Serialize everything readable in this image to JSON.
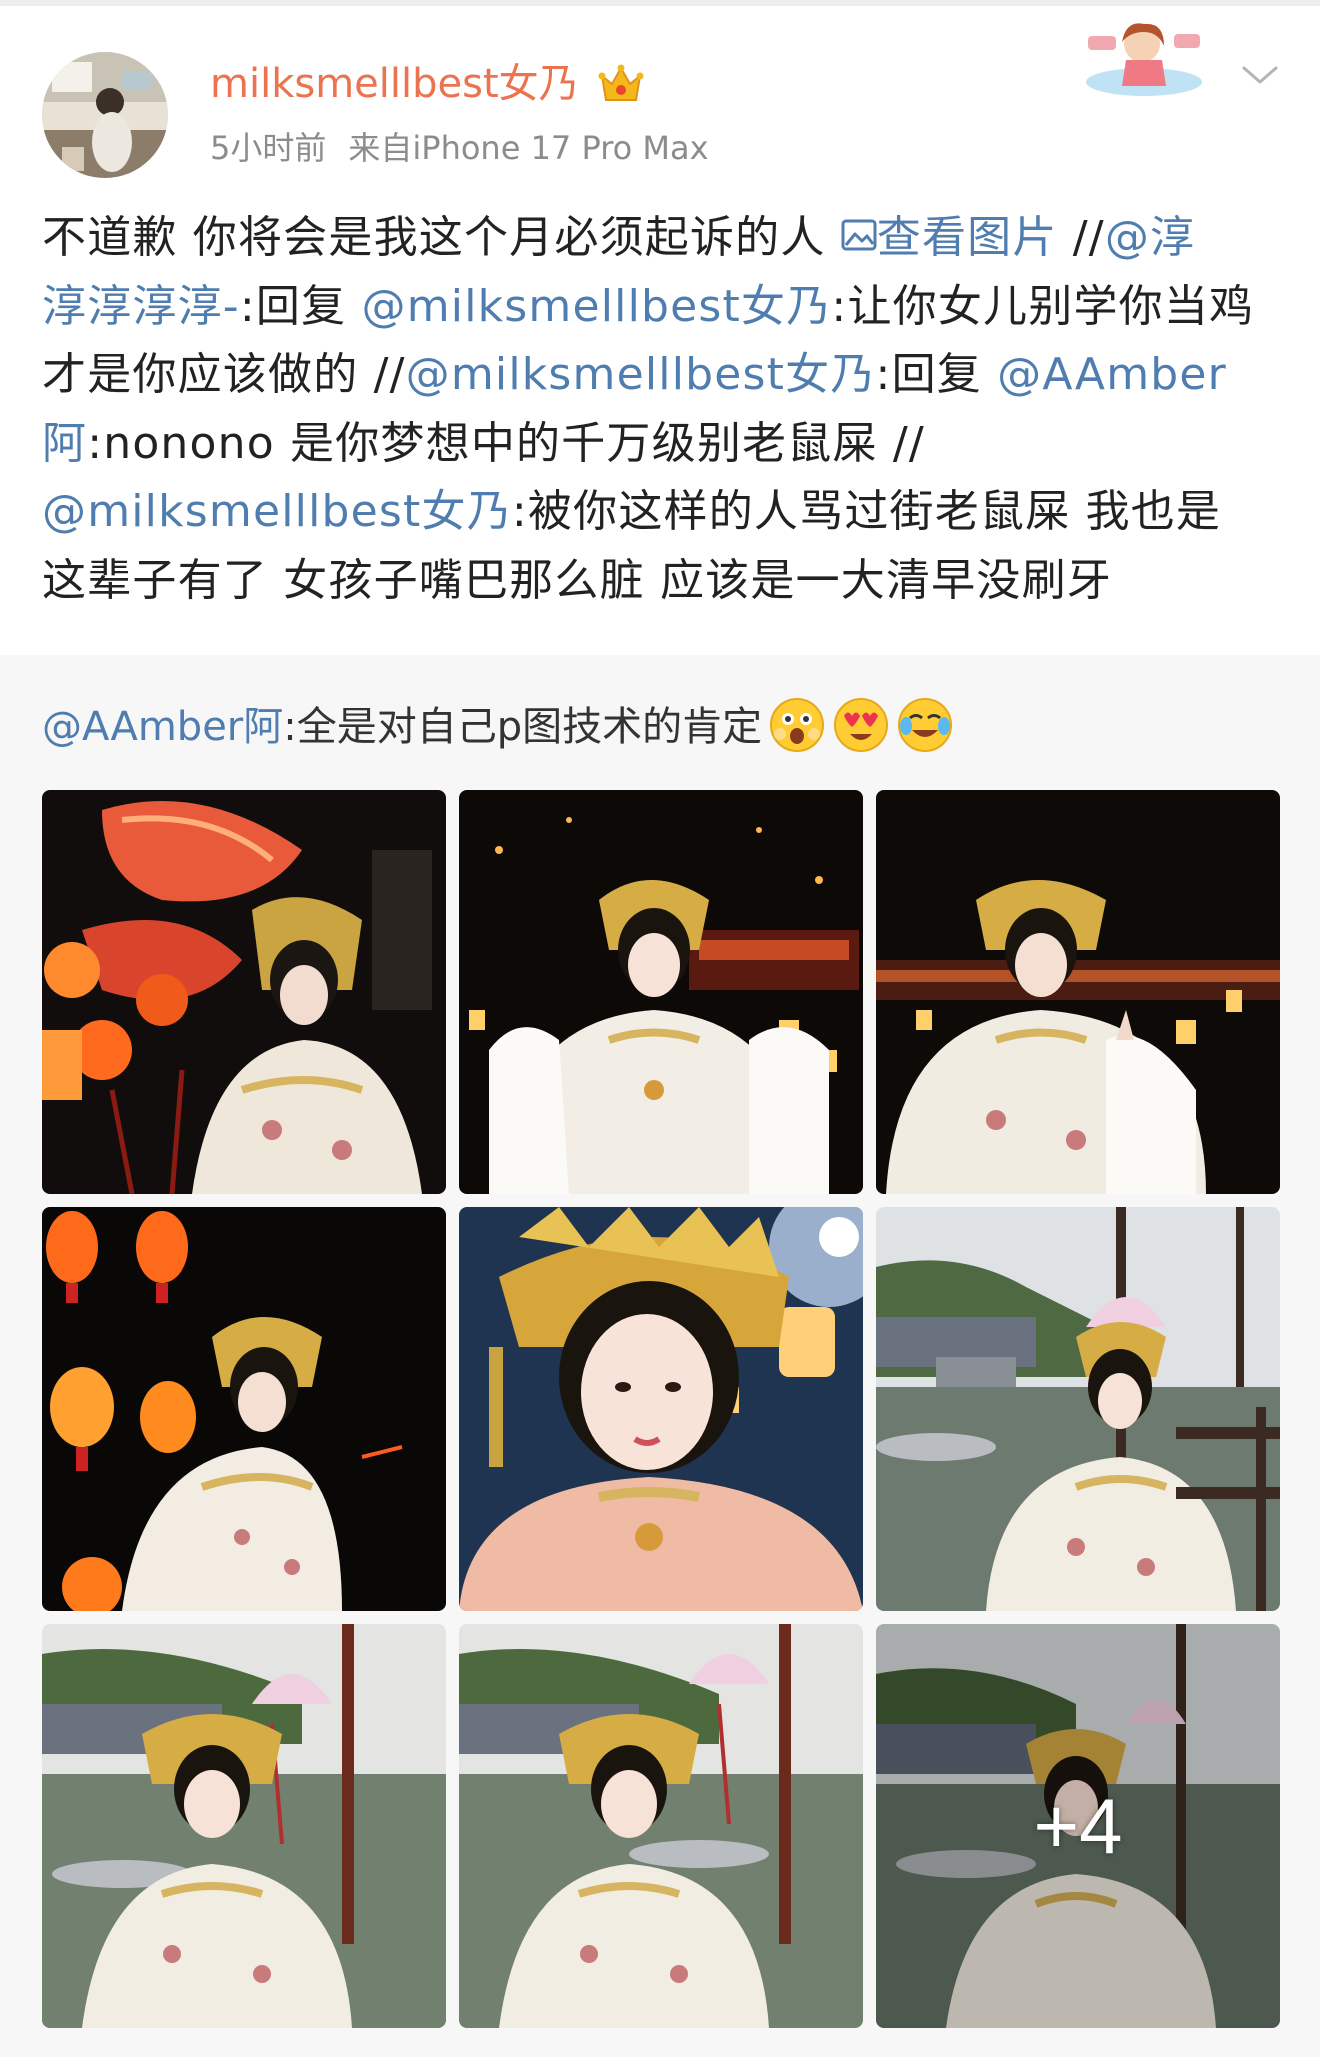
{
  "post": {
    "username": "milksmelllbest女乃",
    "time": "5小时前",
    "source": "来自iPhone 17 Pro Max",
    "lines": [
      [
        {
          "t": "不道歉 你将会是我这个月必须起诉的人 ",
          "type": "text"
        },
        {
          "t": "查看图片",
          "type": "imglink"
        },
        {
          "t": " //",
          "type": "text"
        },
        {
          "t": "@淳",
          "type": "mention"
        }
      ],
      [
        {
          "t": "淳淳淳淳-",
          "type": "mention"
        },
        {
          "t": ":回复 ",
          "type": "text"
        },
        {
          "t": "@milksmelllbest女乃",
          "type": "mention"
        },
        {
          "t": ":让你女儿别学你当鸡",
          "type": "text"
        }
      ],
      [
        {
          "t": "才是你应该做的 //",
          "type": "text"
        },
        {
          "t": "@milksmelllbest女乃",
          "type": "mention"
        },
        {
          "t": ":回复 ",
          "type": "text"
        },
        {
          "t": "@AAmber",
          "type": "mention"
        }
      ],
      [
        {
          "t": "阿",
          "type": "mention"
        },
        {
          "t": ":nonono 是你梦想中的千万级别老鼠屎 //",
          "type": "text"
        }
      ],
      [
        {
          "t": "@milksmelllbest女乃",
          "type": "mention"
        },
        {
          "t": ":被你这样的人骂过街老鼠屎 我也是",
          "type": "text"
        }
      ],
      [
        {
          "t": "这辈子有了 女孩子嘴巴那么脏 应该是一大清早没刷牙",
          "type": "text"
        }
      ]
    ]
  },
  "repost": {
    "author": "@AAmber阿",
    "text": ":全是对自己p图技术的肯定",
    "emojis": [
      "surprised-emoji",
      "heart-eyes-emoji",
      "crying-laugh-emoji"
    ]
  },
  "photos": {
    "count_visible": 9,
    "more_label": "+4"
  },
  "icons": {
    "vip": "crown-icon",
    "expand": "chevron-down-icon",
    "image_link": "image-icon"
  },
  "colors": {
    "username": "#eb7350",
    "mention": "#507daf",
    "text": "#222222",
    "meta": "#8c8c8c",
    "repost_bg": "#f7f7f7"
  }
}
